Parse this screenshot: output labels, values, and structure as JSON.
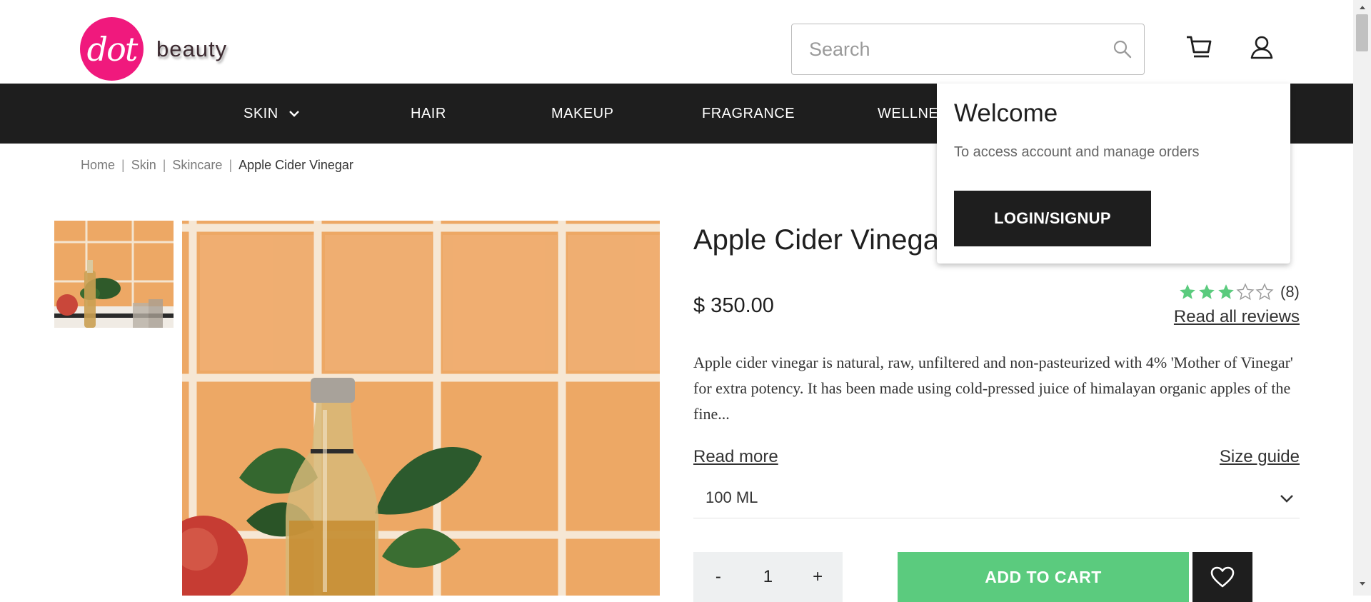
{
  "brand": {
    "logo_mark": "dot",
    "name": "beauty",
    "accent_color": "#f0197d"
  },
  "search": {
    "placeholder": "Search"
  },
  "header_icons": [
    "search-icon",
    "cart-icon",
    "user-icon"
  ],
  "nav": {
    "items": [
      {
        "label": "SKIN",
        "has_dropdown": true
      },
      {
        "label": "HAIR"
      },
      {
        "label": "MAKEUP"
      },
      {
        "label": "FRAGRANCE"
      },
      {
        "label": "WELLNE"
      }
    ]
  },
  "breadcrumb": {
    "items": [
      "Home",
      "Skin",
      "Skincare"
    ],
    "current": "Apple Cider Vinegar",
    "separator": "|"
  },
  "product": {
    "title": "Apple Cider Vinegar",
    "price": "$ 350.00",
    "rating": {
      "value": 3,
      "max": 5,
      "count_text": "(8)",
      "star_color": "#5bcb7e"
    },
    "reviews_link": "Read all reviews",
    "description": "Apple cider vinegar is natural, raw, unfiltered and non-pasteurized with 4% 'Mother of Vinegar' for extra potency. It has been made using cold-pressed juice of himalayan organic apples of the fine...",
    "read_more": "Read more",
    "size_guide": "Size guide",
    "size_selected": "100 ML",
    "quantity": {
      "minus": "-",
      "value": "1",
      "plus": "+"
    },
    "add_to_cart": "ADD TO CART",
    "add_to_cart_color": "#5bcb7e"
  },
  "popup": {
    "title": "Welcome",
    "subtitle": "To access account and manage orders",
    "button": "LOGIN/SIGNUP"
  }
}
